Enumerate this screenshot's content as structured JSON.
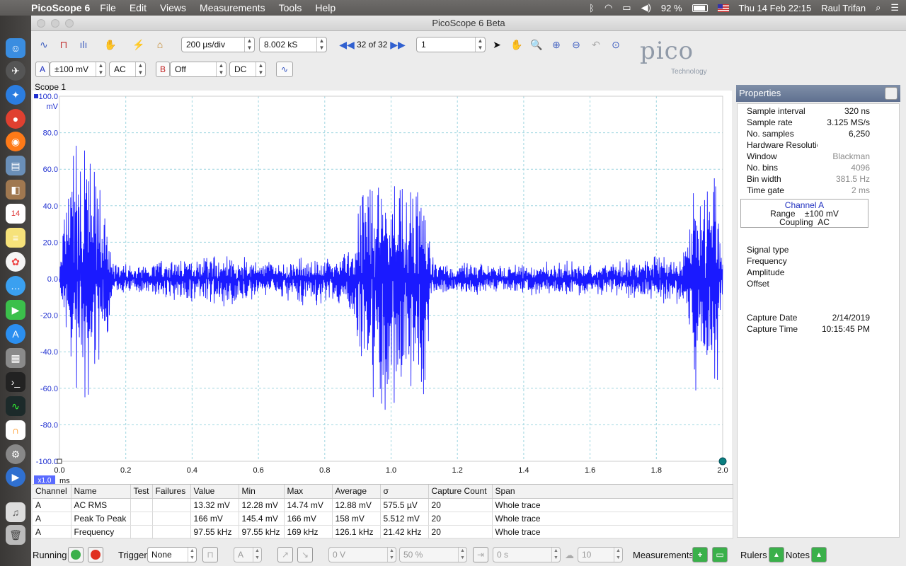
{
  "menubar": {
    "app_name": "PicoScope 6",
    "menus": [
      "File",
      "Edit",
      "Views",
      "Measurements",
      "Tools",
      "Help"
    ],
    "battery": "92 %",
    "clock": "Thu 14 Feb  22:15",
    "user": "Raul Trifan"
  },
  "window": {
    "title": "PicoScope 6 Beta"
  },
  "toolbar": {
    "timebase": "200 µs/div",
    "samples": "8.002 kS",
    "buffer": "32 of 32",
    "captures": "1"
  },
  "channels": {
    "a": {
      "label": "A",
      "range": "±100 mV",
      "coupling": "AC"
    },
    "b": {
      "label": "B",
      "range": "Off",
      "coupling": "DC"
    }
  },
  "logo": {
    "word": "pico",
    "sub": "Technology"
  },
  "scope": {
    "title": "Scope 1",
    "y_unit": "mV",
    "x_unit": "ms",
    "zoom": "x1.0",
    "trace_color": "#1a1aff"
  },
  "chart_data": {
    "type": "line",
    "xlabel": "ms",
    "ylabel": "mV",
    "xlim": [
      0.0,
      2.0
    ],
    "ylim": [
      -100.0,
      100.0
    ],
    "x_ticks": [
      "0.0",
      "0.2",
      "0.4",
      "0.6",
      "0.8",
      "1.0",
      "1.2",
      "1.4",
      "1.6",
      "1.8",
      "2.0"
    ],
    "y_ticks": [
      "100.0",
      "80.0",
      "60.0",
      "40.0",
      "20.0",
      "0.0",
      "-20.0",
      "-40.0",
      "-60.0",
      "-80.0",
      "-100.0"
    ],
    "grid": true,
    "series": [
      {
        "name": "A",
        "x_ms": [
          0.0,
          0.04,
          0.08,
          0.1,
          0.12,
          0.16,
          0.25,
          0.28,
          0.4,
          0.5,
          0.58,
          0.66,
          0.75,
          0.82,
          0.88,
          0.93,
          0.97,
          1.0,
          1.04,
          1.08,
          1.1,
          1.12,
          1.2,
          1.3,
          1.4,
          1.5,
          1.6,
          1.7,
          1.8,
          1.88,
          1.92,
          1.95,
          1.98,
          2.0
        ],
        "envelope_max_mV": [
          8,
          86,
          84,
          75,
          60,
          10,
          8,
          12,
          14,
          16,
          12,
          10,
          14,
          12,
          18,
          70,
          65,
          72,
          62,
          76,
          60,
          15,
          9,
          10,
          8,
          11,
          9,
          12,
          13,
          14,
          70,
          80,
          78,
          12
        ],
        "envelope_min_mV": [
          -8,
          -70,
          -67,
          -60,
          -69,
          -10,
          -9,
          -10,
          -14,
          -18,
          -12,
          -10,
          -16,
          -14,
          -20,
          -72,
          -75,
          -78,
          -70,
          -76,
          -75,
          -15,
          -10,
          -10,
          -9,
          -12,
          -10,
          -12,
          -14,
          -16,
          -68,
          -72,
          -71,
          -12
        ]
      }
    ]
  },
  "measurements": {
    "headers": [
      "Channel",
      "Name",
      "Test",
      "Failures",
      "Value",
      "Min",
      "Max",
      "Average",
      "σ",
      "Capture Count",
      "Span"
    ],
    "rows": [
      [
        "A",
        "AC RMS",
        "",
        "",
        "13.32 mV",
        "12.28 mV",
        "14.74 mV",
        "12.88 mV",
        "575.5 µV",
        "20",
        "Whole trace"
      ],
      [
        "A",
        "Peak To Peak",
        "",
        "",
        "166 mV",
        "145.4 mV",
        "166 mV",
        "158 mV",
        "5.512 mV",
        "20",
        "Whole trace"
      ],
      [
        "A",
        "Frequency",
        "",
        "",
        "97.55 kHz",
        "97.55 kHz",
        "169 kHz",
        "126.1 kHz",
        "21.42 kHz",
        "20",
        "Whole trace"
      ]
    ]
  },
  "properties": {
    "title": "Properties",
    "rows": [
      {
        "k": "Sample interval",
        "v": "320 ns"
      },
      {
        "k": "Sample rate",
        "v": "3.125 MS/s"
      },
      {
        "k": "No. samples",
        "v": "6,250"
      },
      {
        "k": "Hardware Resolutio",
        "v": ""
      },
      {
        "k": "Window",
        "v": "Blackman"
      },
      {
        "k": "No. bins",
        "v": "4096"
      },
      {
        "k": "Bin width",
        "v": "381.5 Hz"
      },
      {
        "k": "Time gate",
        "v": "2 ms"
      }
    ],
    "channel_box": {
      "title": "Channel  A",
      "range_label": "Range",
      "range_value": "±100 mV",
      "coupling_label": "Coupling",
      "coupling_value": "AC"
    },
    "signal_rows": [
      "Signal type",
      "Frequency",
      "Amplitude",
      "Offset"
    ],
    "capture_date_label": "Capture Date",
    "capture_date": "2/14/2019",
    "capture_time_label": "Capture Time",
    "capture_time": "10:15:45 PM"
  },
  "bottombar": {
    "running": "Running",
    "trigger_label": "Trigger",
    "trigger_value": "None",
    "trigger_channel": "A",
    "threshold": "0 V",
    "pretrigger": "50 %",
    "delay": "0 s",
    "hysteresis": "10",
    "measurements": "Measurements",
    "rulers": "Rulers",
    "notes": "Notes"
  }
}
